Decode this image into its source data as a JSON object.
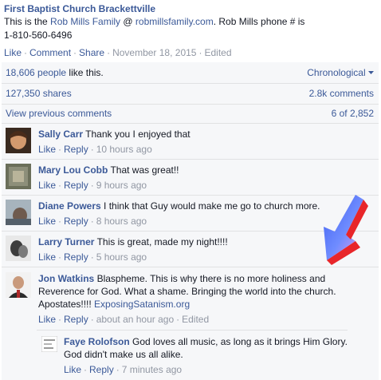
{
  "post": {
    "author": "First Baptist Church Brackettville",
    "text_prefix": "This is the ",
    "family_link": "Rob Mills Family",
    "at": " @ ",
    "site_link": "robmillsfamily.com",
    "text_suffix": ". Rob Mills phone # is",
    "phone": "1-810-560-6496",
    "actions": {
      "like": "Like",
      "comment": "Comment",
      "share": "Share",
      "date": "November 18, 2015",
      "edited": "Edited"
    }
  },
  "feedback": {
    "likes_count": "18,606 people",
    "likes_suffix": "like this.",
    "sort": "Chronological",
    "shares": "127,350 shares",
    "comments_total": "2.8k comments",
    "view_previous": "View previous comments",
    "range": "6 of 2,852"
  },
  "comments": [
    {
      "name": "Sally Carr",
      "text": "Thank you I enjoyed that",
      "like": "Like",
      "reply": "Reply",
      "time": "10 hours ago"
    },
    {
      "name": "Mary Lou Cobb",
      "text": "That was great!!",
      "like": "Like",
      "reply": "Reply",
      "time": "9 hours ago"
    },
    {
      "name": "Diane Powers",
      "text": "I think that Guy would make me go to church more.",
      "like": "Like",
      "reply": "Reply",
      "time": "8 hours ago"
    },
    {
      "name": "Larry Turner",
      "text": "This is great, made my night!!!!",
      "like": "Like",
      "reply": "Reply",
      "time": "5 hours ago"
    },
    {
      "name": "Jon Watkins",
      "text_line1": "Blaspheme. This is why there is no more holiness and",
      "text_line2": "Reverence for God. What a shame. Bringing the world into the church.",
      "text_line3": "Apostates!!!! ",
      "link": "ExposingSatanism.org",
      "like": "Like",
      "reply": "Reply",
      "time": "about an hour ago",
      "edited": "Edited"
    }
  ],
  "reply": {
    "name": "Faye Rolofson",
    "text_line1": "God loves all music, as long as it brings Him Glory.",
    "text_line2": "God didn't make us all alike.",
    "like": "Like",
    "reply": "Reply",
    "time": "7 minutes ago"
  },
  "colors": {
    "link": "#3b5998",
    "muted": "#9197a3",
    "feedback_bg": "#f6f7f9",
    "arrow_blue": "#4a6cf0",
    "arrow_red": "#e8262a"
  },
  "icons": [
    "chevron-down-icon",
    "arrow-annotation"
  ]
}
